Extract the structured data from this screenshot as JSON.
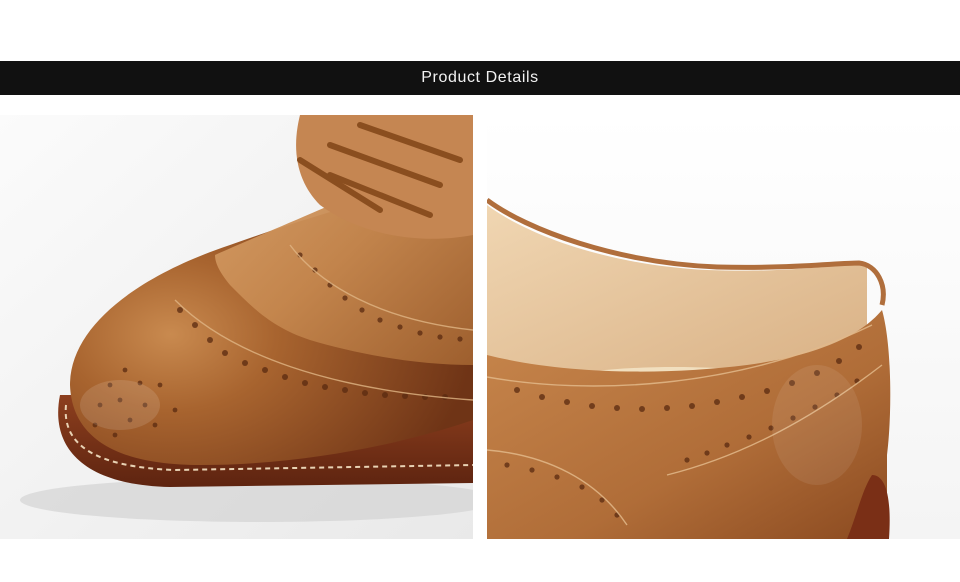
{
  "header": {
    "title": "Product Details"
  },
  "photos": [
    {
      "subject": "toe-brogue-closeup",
      "leather_color": "#b0703a"
    },
    {
      "subject": "heel-collar-closeup",
      "leather_color": "#b67a45"
    }
  ],
  "colors": {
    "banner": "#111111",
    "banner_text": "#f2f2f2",
    "background": "#ffffff",
    "leather_dark": "#7a3e1c",
    "leather_mid": "#b0703a",
    "leather_light": "#d6a06a",
    "sole": "#7b3418",
    "lining": "#e7c8a0"
  }
}
